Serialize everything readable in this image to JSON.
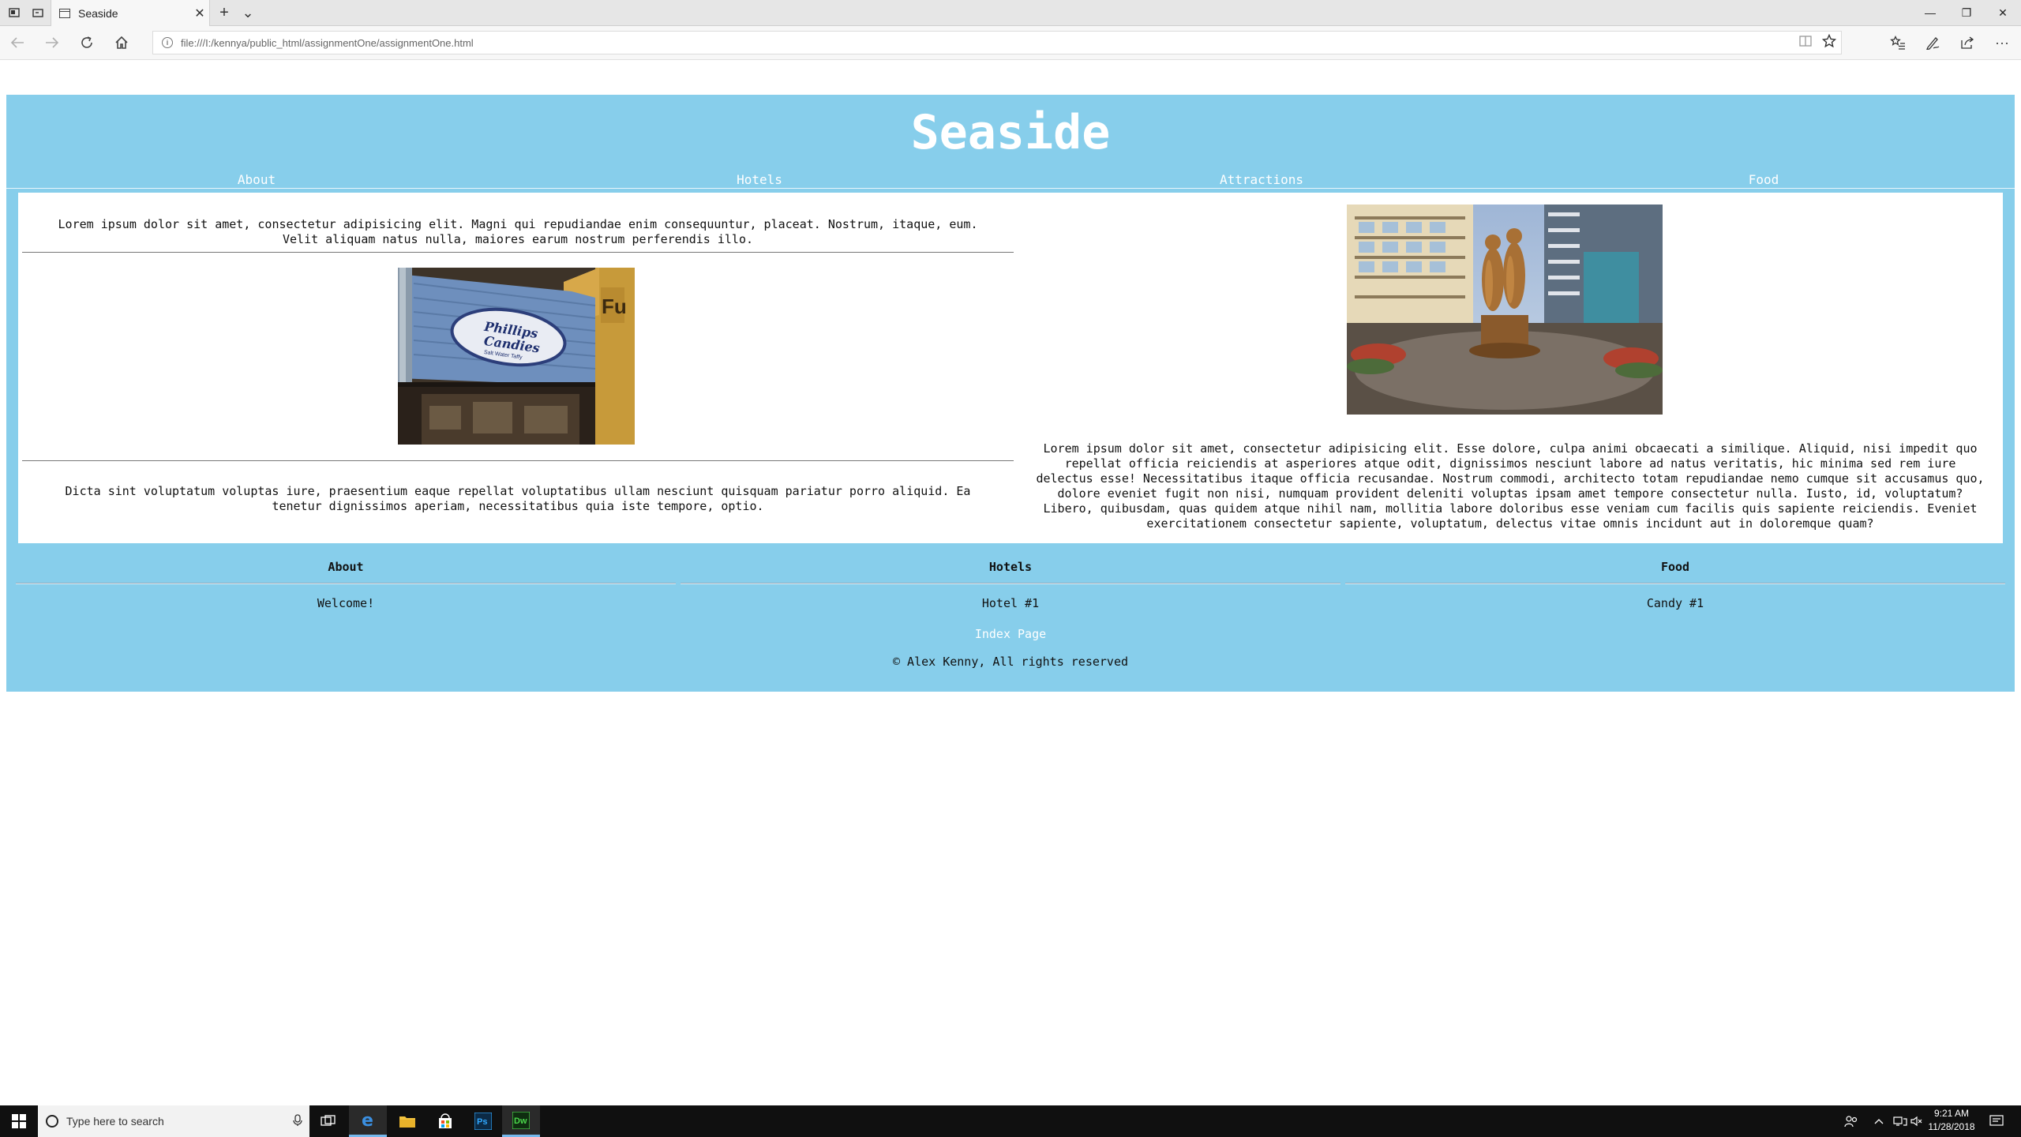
{
  "browser": {
    "tab_title": "Seaside",
    "tab_close": "✕",
    "new_tab": "+",
    "tab_list": "⌄",
    "address": "file:///I:/kennya/public_html/assignmentOne/assignmentOne.html",
    "win_min": "—",
    "win_restore": "❐",
    "win_close": "✕"
  },
  "site": {
    "title": "Seaside",
    "nav": [
      "About",
      "Hotels",
      "Attractions",
      "Food"
    ],
    "left_para_1": "Lorem ipsum dolor sit amet, consectetur adipisicing elit. Magni qui repudiandae enim consequuntur, placeat. Nostrum, itaque, eum. Velit aliquam natus nulla, maiores earum nostrum perferendis illo.",
    "left_para_2": "Dicta sint voluptatum voluptas iure, praesentium eaque repellat voluptatibus ullam nesciunt quisquam pariatur porro aliquid. Ea tenetur dignissimos aperiam, necessitatibus quia iste tempore, optio.",
    "candy_sign_line1": "Phillips",
    "candy_sign_line2": "Candies",
    "candy_sign_line3": "Salt Water Taffy",
    "right_para": "Lorem ipsum dolor sit amet, consectetur adipisicing elit. Esse dolore, culpa animi obcaecati a similique. Aliquid, nisi impedit quo repellat officia reiciendis at asperiores atque odit, dignissimos nesciunt labore ad natus veritatis, hic minima sed rem iure delectus esse! Necessitatibus itaque officia recusandae. Nostrum commodi, architecto totam repudiandae nemo cumque sit accusamus quo, dolore eveniet fugit non nisi, numquam provident deleniti voluptas ipsam amet tempore consectetur nulla. Iusto, id, voluptatum? Libero, quibusdam, quas quidem atque nihil nam, mollitia labore doloribus esse veniam cum facilis quis sapiente reiciendis. Eveniet exercitationem consectetur sapiente, voluptatum, delectus vitae omnis incidunt aut in doloremque quam?",
    "footer": {
      "columns": [
        {
          "heading": "About",
          "item": "Welcome!"
        },
        {
          "heading": "Hotels",
          "item": "Hotel #1"
        },
        {
          "heading": "Food",
          "item": "Candy #1"
        }
      ],
      "index_link": "Index Page",
      "copyright": "© Alex Kenny, All rights reserved"
    },
    "colors": {
      "banner": "#87ceeb",
      "content_bg": "#ffffff"
    }
  },
  "taskbar": {
    "search_placeholder": "Type here to search",
    "time": "9:21 AM",
    "date": "11/28/2018",
    "apps": [
      "task-view-icon",
      "edge-icon",
      "file-explorer-icon",
      "store-icon",
      "photoshop-icon",
      "dreamweaver-icon"
    ],
    "ps_label": "Ps",
    "dw_label": "Dw"
  }
}
